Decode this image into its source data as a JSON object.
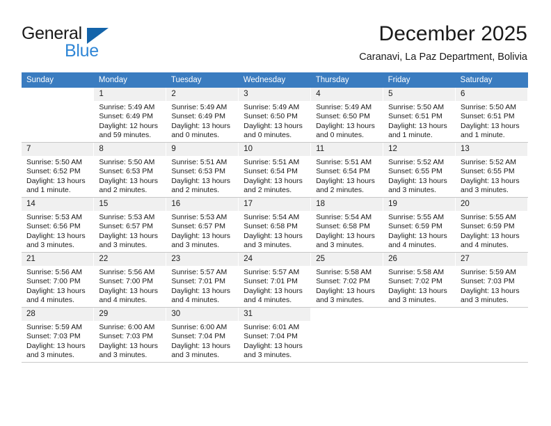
{
  "brand": {
    "name_part1": "General",
    "name_part2": "Blue",
    "triangle_color": "#1464aa",
    "blue_color": "#2f86d6"
  },
  "header": {
    "title": "December 2025",
    "subtitle": "Caranavi, La Paz Department, Bolivia"
  },
  "theme": {
    "header_row_bg": "#3a7cc0",
    "daynum_bg": "#f0f0f0",
    "grid_line": "#c8c8c8"
  },
  "weekday_headers": [
    "Sunday",
    "Monday",
    "Tuesday",
    "Wednesday",
    "Thursday",
    "Friday",
    "Saturday"
  ],
  "weeks": [
    [
      {
        "day": "",
        "info": ""
      },
      {
        "day": "1",
        "info": "Sunrise: 5:49 AM\nSunset: 6:49 PM\nDaylight: 12 hours\nand 59 minutes."
      },
      {
        "day": "2",
        "info": "Sunrise: 5:49 AM\nSunset: 6:49 PM\nDaylight: 13 hours\nand 0 minutes."
      },
      {
        "day": "3",
        "info": "Sunrise: 5:49 AM\nSunset: 6:50 PM\nDaylight: 13 hours\nand 0 minutes."
      },
      {
        "day": "4",
        "info": "Sunrise: 5:49 AM\nSunset: 6:50 PM\nDaylight: 13 hours\nand 0 minutes."
      },
      {
        "day": "5",
        "info": "Sunrise: 5:50 AM\nSunset: 6:51 PM\nDaylight: 13 hours\nand 1 minute."
      },
      {
        "day": "6",
        "info": "Sunrise: 5:50 AM\nSunset: 6:51 PM\nDaylight: 13 hours\nand 1 minute."
      }
    ],
    [
      {
        "day": "7",
        "info": "Sunrise: 5:50 AM\nSunset: 6:52 PM\nDaylight: 13 hours\nand 1 minute."
      },
      {
        "day": "8",
        "info": "Sunrise: 5:50 AM\nSunset: 6:53 PM\nDaylight: 13 hours\nand 2 minutes."
      },
      {
        "day": "9",
        "info": "Sunrise: 5:51 AM\nSunset: 6:53 PM\nDaylight: 13 hours\nand 2 minutes."
      },
      {
        "day": "10",
        "info": "Sunrise: 5:51 AM\nSunset: 6:54 PM\nDaylight: 13 hours\nand 2 minutes."
      },
      {
        "day": "11",
        "info": "Sunrise: 5:51 AM\nSunset: 6:54 PM\nDaylight: 13 hours\nand 2 minutes."
      },
      {
        "day": "12",
        "info": "Sunrise: 5:52 AM\nSunset: 6:55 PM\nDaylight: 13 hours\nand 3 minutes."
      },
      {
        "day": "13",
        "info": "Sunrise: 5:52 AM\nSunset: 6:55 PM\nDaylight: 13 hours\nand 3 minutes."
      }
    ],
    [
      {
        "day": "14",
        "info": "Sunrise: 5:53 AM\nSunset: 6:56 PM\nDaylight: 13 hours\nand 3 minutes."
      },
      {
        "day": "15",
        "info": "Sunrise: 5:53 AM\nSunset: 6:57 PM\nDaylight: 13 hours\nand 3 minutes."
      },
      {
        "day": "16",
        "info": "Sunrise: 5:53 AM\nSunset: 6:57 PM\nDaylight: 13 hours\nand 3 minutes."
      },
      {
        "day": "17",
        "info": "Sunrise: 5:54 AM\nSunset: 6:58 PM\nDaylight: 13 hours\nand 3 minutes."
      },
      {
        "day": "18",
        "info": "Sunrise: 5:54 AM\nSunset: 6:58 PM\nDaylight: 13 hours\nand 3 minutes."
      },
      {
        "day": "19",
        "info": "Sunrise: 5:55 AM\nSunset: 6:59 PM\nDaylight: 13 hours\nand 4 minutes."
      },
      {
        "day": "20",
        "info": "Sunrise: 5:55 AM\nSunset: 6:59 PM\nDaylight: 13 hours\nand 4 minutes."
      }
    ],
    [
      {
        "day": "21",
        "info": "Sunrise: 5:56 AM\nSunset: 7:00 PM\nDaylight: 13 hours\nand 4 minutes."
      },
      {
        "day": "22",
        "info": "Sunrise: 5:56 AM\nSunset: 7:00 PM\nDaylight: 13 hours\nand 4 minutes."
      },
      {
        "day": "23",
        "info": "Sunrise: 5:57 AM\nSunset: 7:01 PM\nDaylight: 13 hours\nand 4 minutes."
      },
      {
        "day": "24",
        "info": "Sunrise: 5:57 AM\nSunset: 7:01 PM\nDaylight: 13 hours\nand 4 minutes."
      },
      {
        "day": "25",
        "info": "Sunrise: 5:58 AM\nSunset: 7:02 PM\nDaylight: 13 hours\nand 3 minutes."
      },
      {
        "day": "26",
        "info": "Sunrise: 5:58 AM\nSunset: 7:02 PM\nDaylight: 13 hours\nand 3 minutes."
      },
      {
        "day": "27",
        "info": "Sunrise: 5:59 AM\nSunset: 7:03 PM\nDaylight: 13 hours\nand 3 minutes."
      }
    ],
    [
      {
        "day": "28",
        "info": "Sunrise: 5:59 AM\nSunset: 7:03 PM\nDaylight: 13 hours\nand 3 minutes."
      },
      {
        "day": "29",
        "info": "Sunrise: 6:00 AM\nSunset: 7:03 PM\nDaylight: 13 hours\nand 3 minutes."
      },
      {
        "day": "30",
        "info": "Sunrise: 6:00 AM\nSunset: 7:04 PM\nDaylight: 13 hours\nand 3 minutes."
      },
      {
        "day": "31",
        "info": "Sunrise: 6:01 AM\nSunset: 7:04 PM\nDaylight: 13 hours\nand 3 minutes."
      },
      {
        "day": "",
        "info": ""
      },
      {
        "day": "",
        "info": ""
      },
      {
        "day": "",
        "info": ""
      }
    ]
  ]
}
